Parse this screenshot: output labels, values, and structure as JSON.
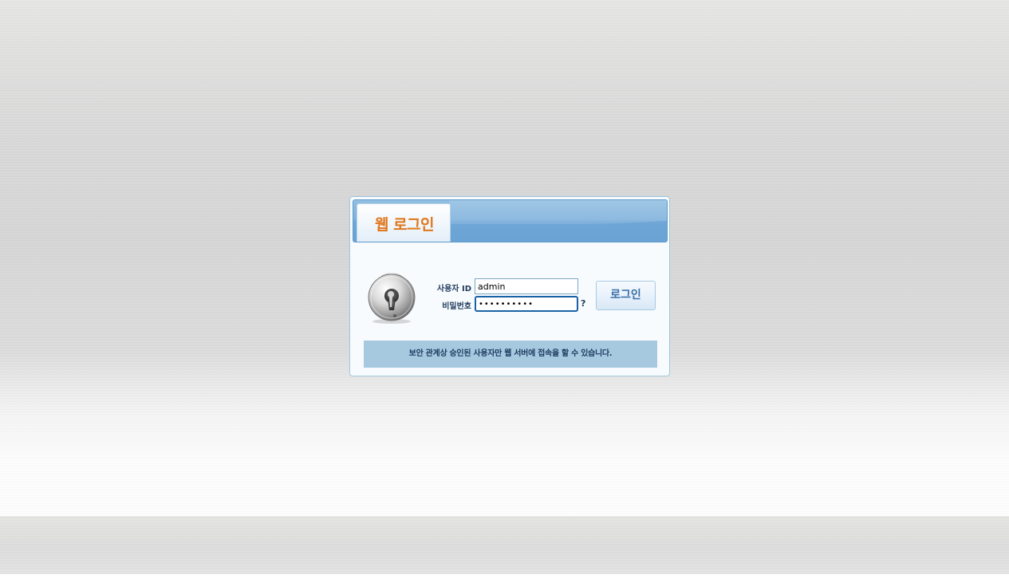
{
  "login": {
    "title": "웹 로그인",
    "user_id_label": "사용자 ID",
    "user_id_value": "admin",
    "password_label": "비밀번호",
    "password_value": "••••••••••",
    "help_label": "?",
    "login_button_label": "로그인",
    "notice": "보안 관계상 승인된 사용자만 웹 서버에 접속을 할 수 있습니다."
  },
  "icons": {
    "lock": "padlock-icon"
  },
  "colors": {
    "title_accent": "#e0761c",
    "header_blue": "#6ea6d6",
    "notice_bg": "#a7c9e0",
    "label_text": "#1e3a5f"
  }
}
